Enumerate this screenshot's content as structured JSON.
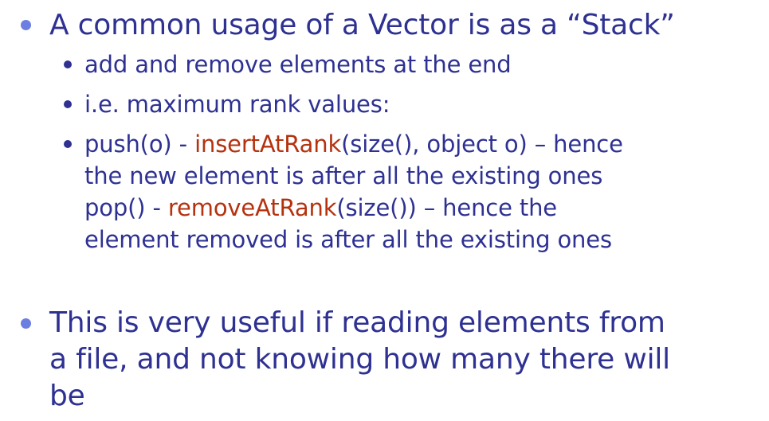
{
  "bullets": {
    "b1": "A common usage of a Vector is as a “Stack”",
    "sub1": "add and remove elements at the end",
    "sub2": "i.e. maximum rank values:",
    "sub3": {
      "line1_a": "push(o) - ",
      "line1_method": "insertAtRank",
      "line1_b": "(size(), object o) – hence",
      "line2": "the new element is after all the existing ones",
      "line3_a": "pop() - ",
      "line3_method": "removeAtRank",
      "line3_b": "(size()) – hence the",
      "line4": "element removed is after all the existing ones"
    },
    "b2": {
      "line1": "This is very useful if reading elements from",
      "line2": "a file, and not knowing how many there will",
      "line3": "be"
    }
  },
  "colors": {
    "text": "#2e3192",
    "method_highlight": "#b5320f",
    "top_bullet": "#6c7ee1"
  }
}
